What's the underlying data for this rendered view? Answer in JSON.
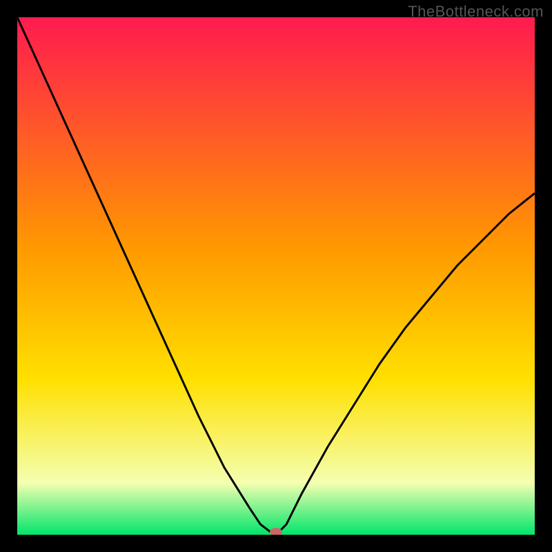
{
  "watermark": "TheBottleneck.com",
  "chart_data": {
    "type": "line",
    "title": "",
    "xlabel": "",
    "ylabel": "",
    "xlim": [
      0,
      100
    ],
    "ylim": [
      0,
      100
    ],
    "background_gradient_top": "#ff1a4f",
    "background_gradient_mid": "#ffd400",
    "background_gradient_bottom": "#00e56a",
    "axes_color": "#000000",
    "curve": {
      "name": "bottleneck-curve",
      "color": "#000000",
      "x": [
        0,
        5,
        10,
        15,
        20,
        25,
        30,
        35,
        40,
        45,
        47,
        49,
        50,
        52,
        55,
        60,
        65,
        70,
        75,
        80,
        85,
        90,
        95,
        100
      ],
      "y": [
        100,
        89,
        78,
        67,
        56,
        45,
        34,
        23,
        13,
        5,
        2,
        0.5,
        0,
        2,
        8,
        17,
        25,
        33,
        40,
        46,
        52,
        57,
        62,
        66
      ]
    },
    "minimum_marker": {
      "x": 50,
      "y": 0,
      "color": "#cc6666"
    }
  }
}
